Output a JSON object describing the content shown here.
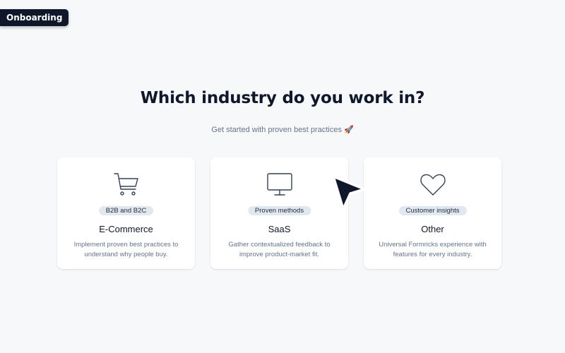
{
  "badge": {
    "label": "Onboarding"
  },
  "header": {
    "title": "Which industry do you work in?",
    "subtitle": "Get started with proven best practices 🚀"
  },
  "cards": [
    {
      "icon": "shopping-cart-icon",
      "tag": "B2B and B2C",
      "title": "E-Commerce",
      "description": "Implement proven best practices to understand why people buy."
    },
    {
      "icon": "monitor-icon",
      "tag": "Proven methods",
      "title": "SaaS",
      "description": "Gather contextualized feedback to improve product-market fit."
    },
    {
      "icon": "heart-icon",
      "tag": "Customer insights",
      "title": "Other",
      "description": "Universal Formricks experience with features for every industry."
    }
  ],
  "colors": {
    "background": "#f7f8fa",
    "text_primary": "#0f172a",
    "text_muted": "#64748b",
    "tag_bg": "#e2e8f0",
    "card_bg": "#ffffff"
  }
}
